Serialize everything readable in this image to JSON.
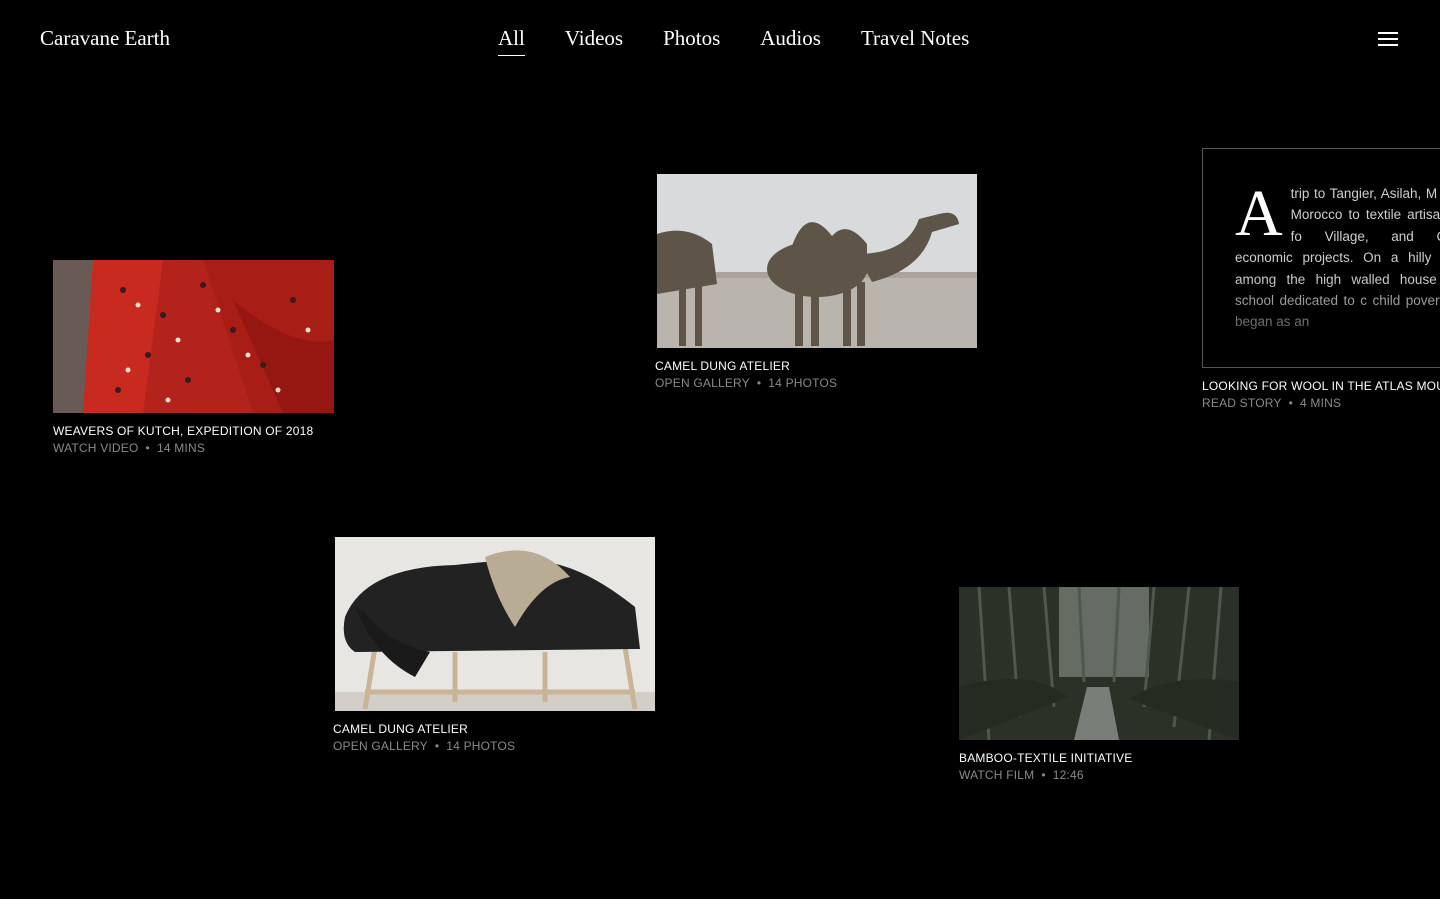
{
  "header": {
    "logo": "Caravane Earth",
    "nav": [
      "All",
      "Videos",
      "Photos",
      "Audios",
      "Travel Notes"
    ],
    "active_nav": "All",
    "menu_icon": "hamburger-menu-icon"
  },
  "cards": {
    "weavers": {
      "title": "WEAVERS OF KUTCH, EXPEDITION OF 2018",
      "action": "WATCH VIDEO",
      "meta": "14 MINS",
      "image": "red-fabric-image"
    },
    "camel": {
      "title": "CAMEL DUNG ATELIER",
      "action": "OPEN GALLERY",
      "meta": "14 PHOTOS",
      "image": "camels-desert-image"
    },
    "wool": {
      "title": "LOOKING FOR WOOL IN THE ATLAS MOUN",
      "action": "READ STORY",
      "meta": "4 MINS",
      "dropcap": "A",
      "text": "trip to Tangier, Asilah, M and Fez, Morocco to textile artisan groups fo Village, and Caravane economic projects. On a hilly street in among the high walled house cheerful school dedicated to c child poverty. Darna began as an"
    },
    "blanket": {
      "title": "CAMEL DUNG ATELIER",
      "action": "OPEN GALLERY",
      "meta": "14 PHOTOS",
      "image": "blanket-bench-image"
    },
    "bamboo": {
      "title": "BAMBOO-TEXTILE INITIATIVE",
      "action": "WATCH FILM",
      "meta": "12:46",
      "image": "bamboo-forest-image"
    }
  }
}
